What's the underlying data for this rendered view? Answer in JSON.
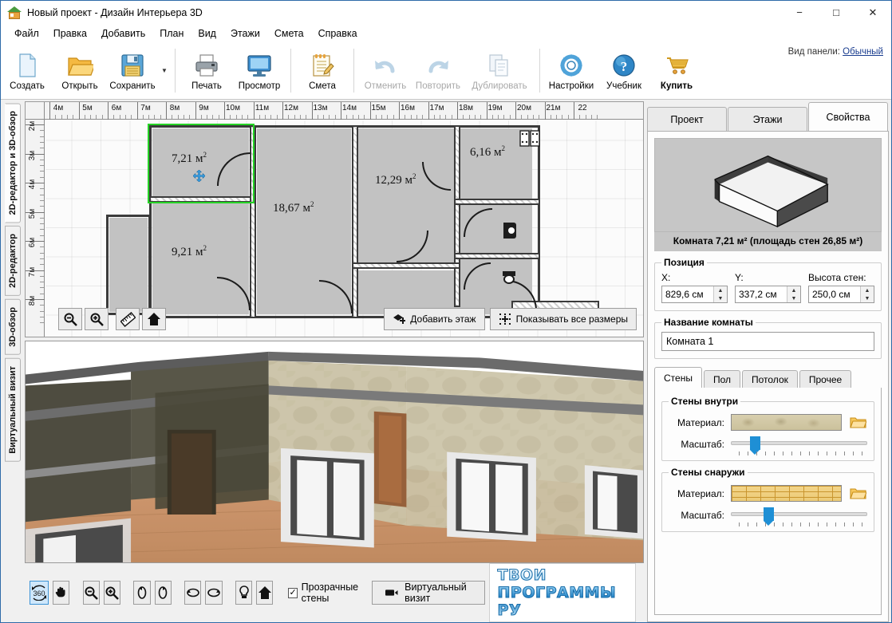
{
  "window": {
    "title": "Новый проект - Дизайн Интерьера 3D",
    "app_icon": "house-icon",
    "minimize": "−",
    "maximize": "□",
    "close": "✕"
  },
  "menu": [
    "Файл",
    "Правка",
    "Добавить",
    "План",
    "Вид",
    "Этажи",
    "Смета",
    "Справка"
  ],
  "toolbar": {
    "buttons": [
      {
        "label": "Создать",
        "icon": "new-document-icon",
        "disabled": false
      },
      {
        "label": "Открыть",
        "icon": "open-folder-icon",
        "disabled": false
      },
      {
        "label": "Сохранить",
        "icon": "save-floppy-icon",
        "disabled": false
      },
      {
        "label": "Печать",
        "icon": "printer-icon",
        "disabled": false
      },
      {
        "label": "Просмотр",
        "icon": "monitor-icon",
        "disabled": false
      },
      {
        "label": "Смета",
        "icon": "estimate-notepad-icon",
        "disabled": false
      },
      {
        "label": "Отменить",
        "icon": "undo-arrow-icon",
        "disabled": true
      },
      {
        "label": "Повторить",
        "icon": "redo-arrow-icon",
        "disabled": true
      },
      {
        "label": "Дублировать",
        "icon": "duplicate-pages-icon",
        "disabled": true
      },
      {
        "label": "Настройки",
        "icon": "gear-icon",
        "disabled": false
      },
      {
        "label": "Учебник",
        "icon": "help-question-icon",
        "disabled": false
      },
      {
        "label": "Купить",
        "icon": "shopping-cart-icon",
        "disabled": false
      }
    ],
    "panel_view_label": "Вид панели:",
    "panel_view_value": "Обычный"
  },
  "sidebar": {
    "items": [
      {
        "label": "2D-редактор и 3D-обзор",
        "active": true
      },
      {
        "label": "2D-редактор",
        "active": false
      },
      {
        "label": "3D-обзор",
        "active": false
      },
      {
        "label": "Виртуальный визит",
        "active": false
      }
    ]
  },
  "plan": {
    "ruler_h": [
      "4м",
      "5м",
      "6м",
      "7м",
      "8м",
      "9м",
      "10м",
      "11м",
      "12м",
      "13м",
      "14м",
      "15м",
      "16м",
      "17м",
      "18м",
      "19м",
      "20м",
      "21м",
      "22"
    ],
    "ruler_v": [
      "2м",
      "3м",
      "4м",
      "5м",
      "6м",
      "7м",
      "8м"
    ],
    "rooms": [
      {
        "area": "7,21 м",
        "sup": "2",
        "selected": true
      },
      {
        "area": "9,21 м",
        "sup": "2",
        "selected": false
      },
      {
        "area": "18,67 м",
        "sup": "2",
        "selected": false
      },
      {
        "area": "12,29 м",
        "sup": "2",
        "selected": false
      },
      {
        "area": "6,16 м",
        "sup": "2",
        "selected": false
      }
    ],
    "tools": [
      {
        "name": "zoom-out-icon",
        "glyph": "⊖"
      },
      {
        "name": "zoom-in-icon",
        "glyph": "⊕"
      },
      {
        "name": "ruler-icon",
        "glyph": "📏"
      },
      {
        "name": "home-icon",
        "glyph": "⌂"
      }
    ],
    "add_floor_button": "Добавить этаж",
    "show_sizes_button": "Показывать все размеры"
  },
  "view3d": {
    "toolbar": [
      {
        "name": "rotate-360-icon",
        "label": "360",
        "active": true
      },
      {
        "name": "pan-hand-icon",
        "label": "✋",
        "active": false
      },
      {
        "name": "zoom-out-icon",
        "label": "⊖",
        "active": false
      },
      {
        "name": "zoom-in-icon",
        "label": "⊕",
        "active": false
      },
      {
        "name": "rotate-vertical-left-icon",
        "label": "↺",
        "active": false
      },
      {
        "name": "rotate-vertical-right-icon",
        "label": "↻",
        "active": false
      },
      {
        "name": "rotate-horizontal-left-icon",
        "label": "⟲",
        "active": false
      },
      {
        "name": "rotate-horizontal-right-icon",
        "label": "⟳",
        "active": false
      },
      {
        "name": "light-bulb-icon",
        "label": "💡",
        "active": false
      },
      {
        "name": "home-icon",
        "label": "⌂",
        "active": false
      }
    ],
    "transparent_walls_label": "Прозрачные стены",
    "transparent_walls_checked": true,
    "virtual_visit_button": "Виртуальный визит"
  },
  "watermark": "ТВОИ ПРОГРАММЫ РУ",
  "properties": {
    "tabs": [
      {
        "label": "Проект",
        "active": false
      },
      {
        "label": "Этажи",
        "active": false
      },
      {
        "label": "Свойства",
        "active": true
      }
    ],
    "preview_caption": "Комната 7,21 м²  (площадь стен 26,85 м²)",
    "position": {
      "legend": "Позиция",
      "x_label": "X:",
      "x_value": "829,6 см",
      "y_label": "Y:",
      "y_value": "337,2 см",
      "h_label": "Высота стен:",
      "h_value": "250,0 см"
    },
    "room_name": {
      "legend": "Название комнаты",
      "value": "Комната 1"
    },
    "surface_tabs": [
      {
        "label": "Стены",
        "active": true
      },
      {
        "label": "Пол",
        "active": false
      },
      {
        "label": "Потолок",
        "active": false
      },
      {
        "label": "Прочее",
        "active": false
      }
    ],
    "walls_inside": {
      "legend": "Стены внутри",
      "material_label": "Материал:",
      "scale_label": "Масштаб:",
      "scale_percent": 14
    },
    "walls_outside": {
      "legend": "Стены снаружи",
      "material_label": "Материал:",
      "scale_label": "Масштаб:",
      "scale_percent": 24
    }
  },
  "colors": {
    "accent": "#1e8fd5",
    "selection_green": "#25d425",
    "window_border": "#2e6ba8"
  }
}
